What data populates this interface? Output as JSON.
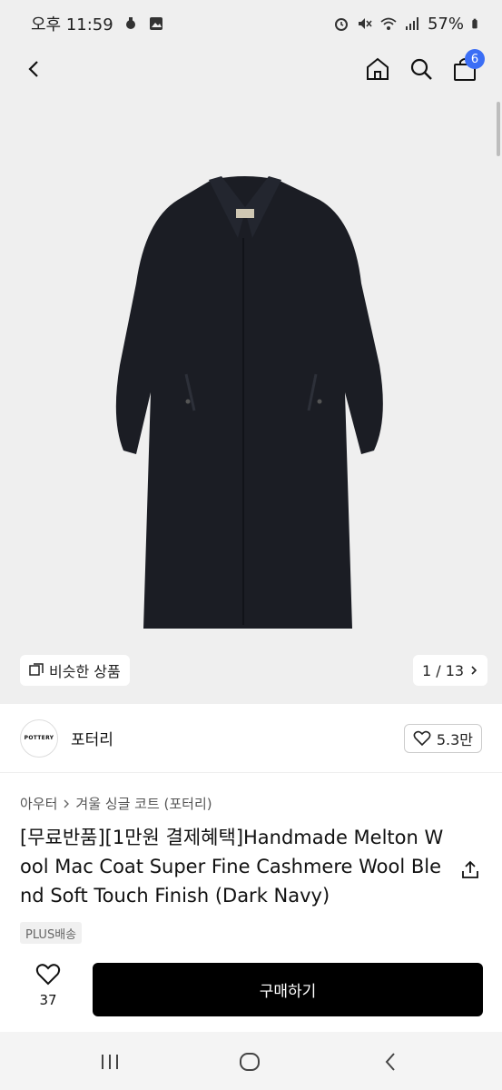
{
  "status_bar": {
    "time": "오후 11:59",
    "battery": "57%"
  },
  "header": {
    "cart_count": "6"
  },
  "gallery": {
    "similar_label": "비슷한 상품",
    "page_indicator": "1 / 13"
  },
  "brand": {
    "logo_text": "POTTERY",
    "name": "포터리",
    "likes": "5.3만"
  },
  "breadcrumb": {
    "category": "아우터",
    "subcategory": "겨울 싱글 코트 (포터리)"
  },
  "product": {
    "title": "[무료반품][1만원 결제혜택]Handmade Melton Wool Mac Coat Super Fine Cashmere Wool Blend Soft Touch Finish (Dark Navy)",
    "shipping_tag": "PLUS배송"
  },
  "bottom_bar": {
    "wish_count": "37",
    "buy_label": "구매하기"
  },
  "colors": {
    "accent": "#3b6ef5",
    "coat": "#1b1d24",
    "background": "#efefef",
    "buy_button": "#000000"
  }
}
